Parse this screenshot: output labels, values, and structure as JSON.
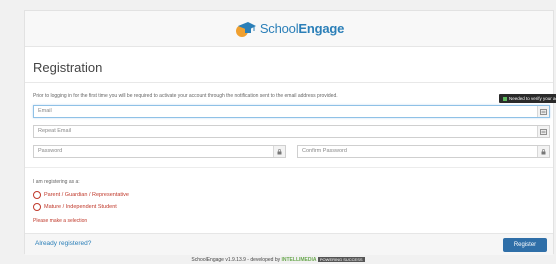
{
  "brand": {
    "name_prefix": "School",
    "name_suffix": "Engage"
  },
  "page": {
    "title": "Registration",
    "intro": "Prior to logging in for the first time you will be required to activate your account through the notification sent to the email address provided.",
    "tooltip": "Needed to verify your account"
  },
  "form": {
    "email_placeholder": "Email",
    "repeat_email_placeholder": "Repeat Email",
    "password_placeholder": "Password",
    "confirm_password_placeholder": "Confirm Password"
  },
  "registering": {
    "label": "I am registering as a:",
    "options": [
      "Parent / Guardian / Representative",
      "Mature / Independent Student"
    ],
    "error": "Please make a selection"
  },
  "footer": {
    "already_registered": "Already registered?",
    "register_button": "Register",
    "credit_text": "SchoolEngage v1.9.13.9 - developed by ",
    "credit_brand": "INTELLIMEDIA",
    "credit_badge": "POWERING SUCCESS"
  },
  "colors": {
    "accent": "#2b7fb8",
    "button": "#2f6fa8",
    "error": "#c0392b",
    "logo_orange": "#f0a030",
    "logo_blue": "#2b7fb8"
  }
}
